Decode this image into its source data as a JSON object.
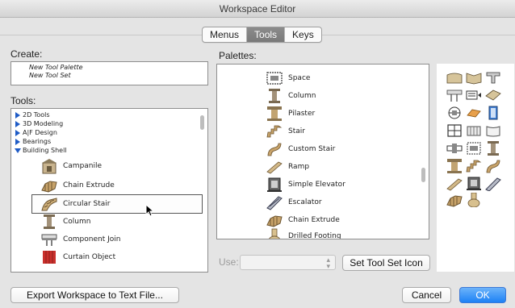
{
  "window": {
    "title": "Workspace Editor"
  },
  "tabs": [
    {
      "label": "Menus",
      "active": false
    },
    {
      "label": "Tools",
      "active": true
    },
    {
      "label": "Keys",
      "active": false
    }
  ],
  "create": {
    "label": "Create:",
    "items": [
      "New Tool Palette",
      "New Tool Set"
    ]
  },
  "tools": {
    "label": "Tools:",
    "groups": [
      {
        "label": "2D Tools",
        "expanded": false
      },
      {
        "label": "3D Modeling",
        "expanded": false
      },
      {
        "label": "A|F Design",
        "expanded": false
      },
      {
        "label": "Bearings",
        "expanded": false
      },
      {
        "label": "Building Shell",
        "expanded": true
      }
    ],
    "items": [
      {
        "label": "Campanile",
        "icon": "campanile-icon",
        "selected": false
      },
      {
        "label": "Chain Extrude",
        "icon": "chain-extrude-icon",
        "selected": false
      },
      {
        "label": "Circular Stair",
        "icon": "circular-stair-icon",
        "selected": true
      },
      {
        "label": "Column",
        "icon": "column-icon",
        "selected": false
      },
      {
        "label": "Component Join",
        "icon": "component-join-icon",
        "selected": false
      },
      {
        "label": "Curtain Object",
        "icon": "curtain-object-icon",
        "selected": false
      }
    ]
  },
  "palettes": {
    "label": "Palettes:",
    "items": [
      {
        "label": "Space",
        "icon": "space-icon"
      },
      {
        "label": "Column",
        "icon": "column-icon"
      },
      {
        "label": "Pilaster",
        "icon": "pilaster-icon"
      },
      {
        "label": "Stair",
        "icon": "stair-icon"
      },
      {
        "label": "Custom Stair",
        "icon": "custom-stair-icon"
      },
      {
        "label": "Ramp",
        "icon": "ramp-icon"
      },
      {
        "label": "Simple Elevator",
        "icon": "simple-elevator-icon"
      },
      {
        "label": "Escalator",
        "icon": "escalator-icon"
      },
      {
        "label": "Chain Extrude",
        "icon": "chain-extrude-icon"
      },
      {
        "label": "Drilled Footing",
        "icon": "drilled-footing-icon"
      }
    ]
  },
  "controls": {
    "use_label": "Use:",
    "use_value": "",
    "set_icon_button": "Set Tool Set Icon",
    "export_button": "Export Workspace to Text File...",
    "cancel_button": "Cancel",
    "ok_button": "OK"
  },
  "colors": {
    "accent": "#1d81f5",
    "tree_triangle": "#1e5bc6",
    "icon_gold": "#c8a36a",
    "icon_dark": "#3d3d3d"
  }
}
